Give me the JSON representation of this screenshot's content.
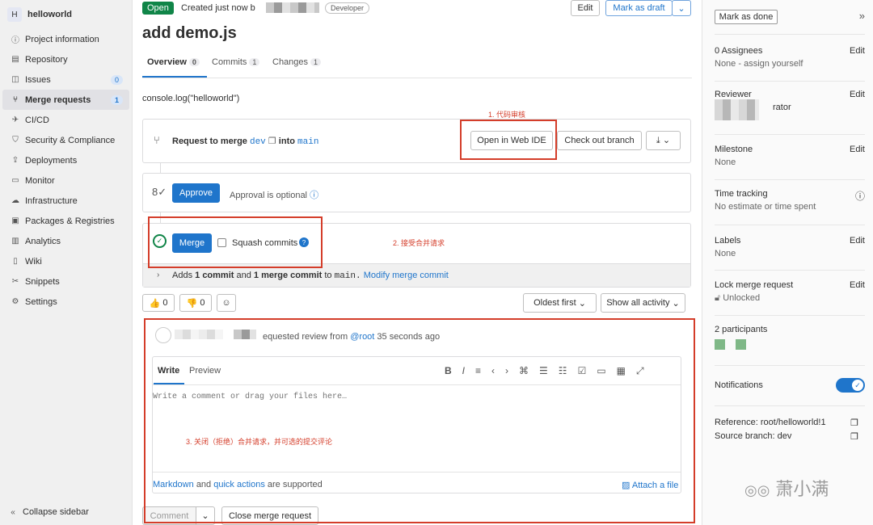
{
  "project": {
    "avatar_letter": "H",
    "name": "helloworld"
  },
  "nav": {
    "project_information": "Project information",
    "repository": "Repository",
    "issues": "Issues",
    "issues_count": "0",
    "merge_requests": "Merge requests",
    "merge_requests_count": "1",
    "cicd": "CI/CD",
    "security": "Security & Compliance",
    "deployments": "Deployments",
    "monitor": "Monitor",
    "infrastructure": "Infrastructure",
    "packages": "Packages & Registries",
    "analytics": "Analytics",
    "wiki": "Wiki",
    "snippets": "Snippets",
    "settings": "Settings",
    "collapse": "Collapse sidebar"
  },
  "header": {
    "status": "Open",
    "created": "Created just now b",
    "role": "Developer",
    "edit": "Edit",
    "mark_draft": "Mark as draft",
    "title": "add demo.js"
  },
  "tabs": {
    "overview": "Overview",
    "overview_count": "0",
    "commits": "Commits",
    "commits_count": "1",
    "changes": "Changes",
    "changes_count": "1"
  },
  "description": "console.log(\"helloworld\")",
  "merge_box": {
    "request_to_merge": "Request to merge",
    "source": "dev",
    "into": "into",
    "target": "main",
    "open_web_ide": "Open in Web IDE",
    "checkout": "Check out branch"
  },
  "approve": {
    "button": "Approve",
    "text": "Approval is optional"
  },
  "merge": {
    "button": "Merge",
    "squash": "Squash commits",
    "adds_prefix": "Adds",
    "one_commit": "1 commit",
    "and": "and",
    "one_merge_commit": "1 merge commit",
    "to": "to",
    "branch": "main.",
    "modify": "Modify merge commit"
  },
  "reactions": {
    "thumbs_up": "0",
    "thumbs_down": "0"
  },
  "filters": {
    "oldest_first": "Oldest first",
    "show_all": "Show all activity"
  },
  "activity": {
    "text": "equested review from",
    "mention": "@root",
    "time": "35 seconds ago"
  },
  "comment": {
    "write": "Write",
    "preview": "Preview",
    "placeholder": "Write a comment or drag your files here…",
    "markdown": "Markdown",
    "and": "and",
    "quick_actions": "quick actions",
    "supported": "are supported",
    "attach": "Attach a file",
    "comment_btn": "Comment",
    "close_mr": "Close merge request"
  },
  "annotations": {
    "a1": "1. 代码审核",
    "a2": "2. 接受合并请求",
    "a3": "3. 关闭（拒绝）合并请求，并可选的提交评论"
  },
  "right": {
    "mark_done": "Mark as done",
    "assignees_title": "0 Assignees",
    "assignees_val": "None - assign yourself",
    "reviewer_title": "Reviewer",
    "reviewer_name": "rator",
    "milestone_title": "Milestone",
    "milestone_val": "None",
    "time_title": "Time tracking",
    "time_val": "No estimate or time spent",
    "labels_title": "Labels",
    "labels_val": "None",
    "lock_title": "Lock merge request",
    "lock_val": "Unlocked",
    "participants": "2 participants",
    "notifications": "Notifications",
    "reference": "Reference: root/helloworld!1",
    "source_branch": "Source branch: dev",
    "edit": "Edit"
  },
  "watermark": "萧小满"
}
